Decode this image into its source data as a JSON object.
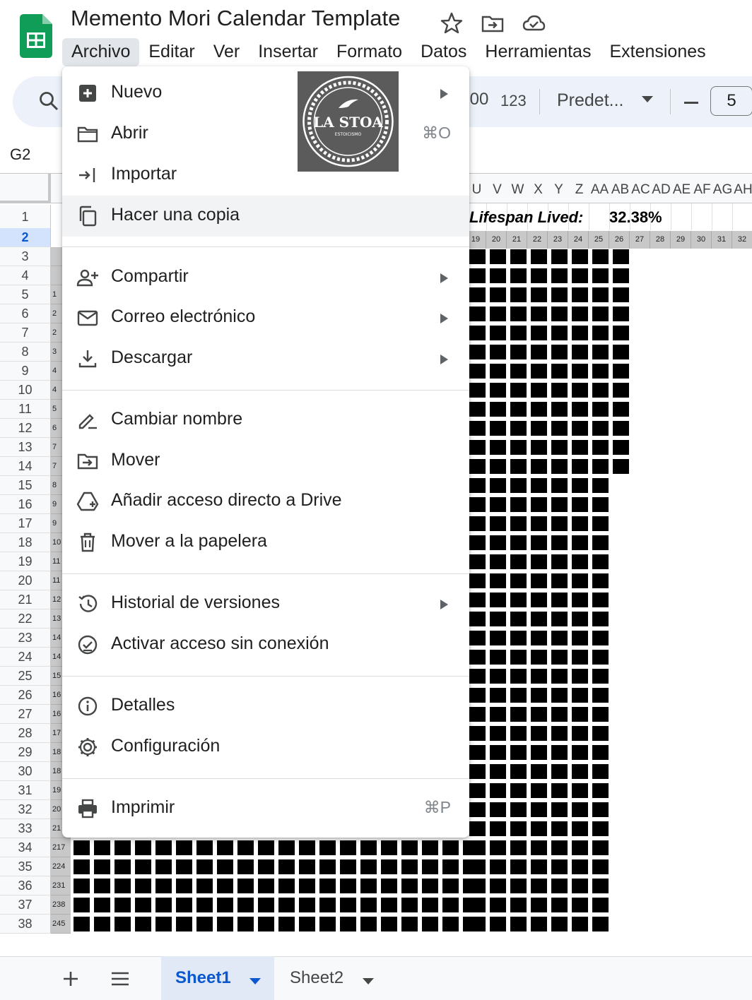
{
  "document": {
    "title": "Memento Mori Calendar Template",
    "icons": [
      "star-icon",
      "move-folder-icon",
      "cloud-saved-icon"
    ]
  },
  "menubar": {
    "items": [
      "Archivo",
      "Editar",
      "Ver",
      "Insertar",
      "Formato",
      "Datos",
      "Herramientas",
      "Extensiones"
    ],
    "active": "Archivo"
  },
  "toolbar": {
    "decimal_label": ".00",
    "number_format_label": "123",
    "font": "Predet...",
    "font_size": "5"
  },
  "namebox": "G2",
  "grid": {
    "columns": [
      "U",
      "V",
      "W",
      "X",
      "Y",
      "Z",
      "AA",
      "AB",
      "AC",
      "AD",
      "AE",
      "AF",
      "AG",
      "AH"
    ],
    "rows": [
      "1",
      "2",
      "3",
      "4",
      "5",
      "6",
      "7",
      "8",
      "9",
      "10",
      "11",
      "12",
      "13",
      "14",
      "15",
      "16",
      "17",
      "18",
      "19",
      "20",
      "21",
      "22",
      "23",
      "24",
      "25",
      "26",
      "27",
      "28",
      "29",
      "30",
      "31",
      "32",
      "33",
      "34",
      "35",
      "36",
      "37",
      "38"
    ],
    "selected_row": "2",
    "row1_label": "Lifespan Lived:",
    "row1_value": "32.38%",
    "week_numbers": [
      "19",
      "20",
      "21",
      "22",
      "23",
      "24",
      "25",
      "26",
      "27",
      "28",
      "29",
      "30",
      "31",
      "32"
    ],
    "col_a_values": [
      "1",
      "2",
      "2",
      "3",
      "4",
      "4",
      "5",
      "6",
      "7",
      "7",
      "8",
      "9",
      "9",
      "10",
      "11",
      "11",
      "12",
      "13",
      "14",
      "14",
      "15",
      "16",
      "16",
      "17",
      "18",
      "18",
      "19",
      "20",
      "21",
      "217",
      "224",
      "231",
      "238",
      "245"
    ]
  },
  "sheets": {
    "tabs": [
      "Sheet1",
      "Sheet2"
    ],
    "active": "Sheet1"
  },
  "file_menu": {
    "logo_text": "LA STOA",
    "logo_subtext": "ESTOICISMO",
    "items": [
      {
        "label": "Nuevo",
        "icon": "new-sheet-icon",
        "submenu": true
      },
      {
        "label": "Abrir",
        "icon": "folder-open-icon",
        "shortcut": "⌘O"
      },
      {
        "label": "Importar",
        "icon": "import-icon"
      },
      {
        "label": "Hacer una copia",
        "icon": "copy-icon"
      },
      {
        "label": "Compartir",
        "icon": "share-person-icon",
        "submenu": true
      },
      {
        "label": "Correo electrónico",
        "icon": "mail-icon",
        "submenu": true
      },
      {
        "label": "Descargar",
        "icon": "download-icon",
        "submenu": true
      },
      {
        "label": "Cambiar nombre",
        "icon": "rename-icon"
      },
      {
        "label": "Mover",
        "icon": "move-folder-icon"
      },
      {
        "label": "Añadir acceso directo a Drive",
        "icon": "drive-shortcut-icon"
      },
      {
        "label": "Mover a la papelera",
        "icon": "trash-icon"
      },
      {
        "label": "Historial de versiones",
        "icon": "history-icon",
        "submenu": true
      },
      {
        "label": "Activar acceso sin conexión",
        "icon": "offline-icon"
      },
      {
        "label": "Detalles",
        "icon": "info-icon"
      },
      {
        "label": "Configuración",
        "icon": "settings-icon"
      },
      {
        "label": "Imprimir",
        "icon": "print-icon",
        "shortcut": "⌘P"
      }
    ],
    "hovered_item": "Hacer una copia"
  },
  "colors": {
    "accent": "#0b57d0",
    "sheets_green": "#0f9d58",
    "toolbar_bg": "#edf2fa",
    "week_fill": "#000000"
  }
}
